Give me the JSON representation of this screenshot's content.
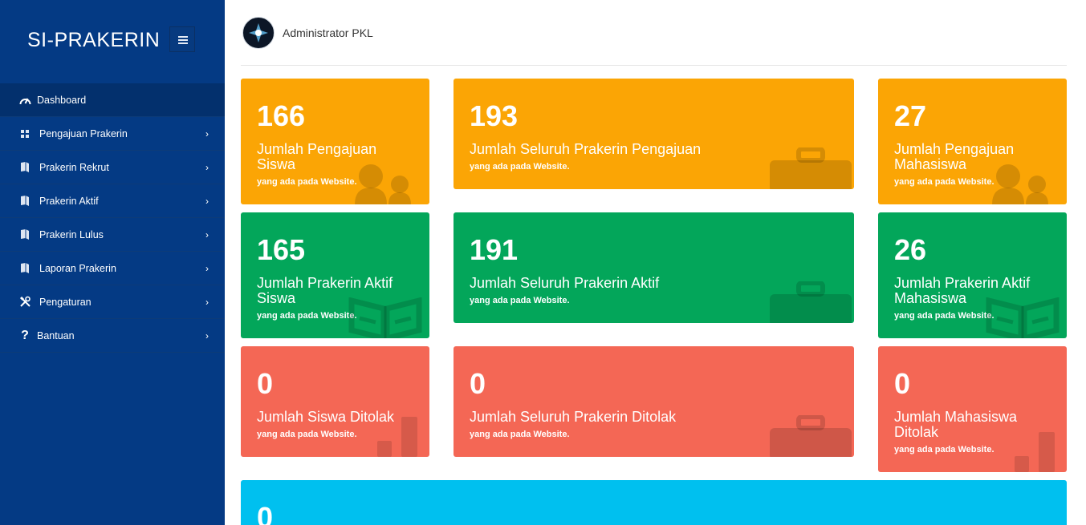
{
  "app": {
    "brand": "SI-PRAKERIN"
  },
  "sidebar": {
    "items": [
      {
        "label": "Dashboard",
        "icon": "dashboard-icon"
      },
      {
        "label": "Pengajuan Prakerin",
        "icon": "grid-icon"
      },
      {
        "label": "Prakerin Rekrut",
        "icon": "book-icon"
      },
      {
        "label": "Prakerin Aktif",
        "icon": "book-icon"
      },
      {
        "label": "Prakerin Lulus",
        "icon": "book-icon"
      },
      {
        "label": "Laporan Prakerin",
        "icon": "book-icon"
      },
      {
        "label": "Pengaturan",
        "icon": "tools-icon"
      },
      {
        "label": "Bantuan",
        "icon": "help-icon"
      }
    ],
    "chevron": "›"
  },
  "header": {
    "user_name": "Administrator PKL"
  },
  "colors": {
    "sidebar": "#043a84",
    "orange": "#fba505",
    "green": "#03a65a",
    "red": "#f46755",
    "blue": "#00c0ef"
  },
  "cards": [
    {
      "value": "166",
      "title": "Jumlah Pengajuan Siswa",
      "sub": "yang ada pada Website.",
      "icon": "users-icon"
    },
    {
      "value": "193",
      "title": "Jumlah Seluruh Prakerin Pengajuan",
      "sub": "yang ada pada Website.",
      "icon": "briefcase-icon"
    },
    {
      "value": "27",
      "title": "Jumlah Pengajuan Mahasiswa",
      "sub": "yang ada pada Website.",
      "icon": "users-icon"
    },
    {
      "value": "165",
      "title": "Jumlah Prakerin Aktif Siswa",
      "sub": "yang ada pada Website.",
      "icon": "book-open-icon"
    },
    {
      "value": "191",
      "title": "Jumlah Seluruh Prakerin Aktif",
      "sub": "yang ada pada Website.",
      "icon": "briefcase-icon"
    },
    {
      "value": "26",
      "title": "Jumlah Prakerin Aktif Mahasiswa",
      "sub": "yang ada pada Website.",
      "icon": "book-open-icon"
    },
    {
      "value": "0",
      "title": "Jumlah Siswa Ditolak",
      "sub": "yang ada pada Website.",
      "icon": "bar-chart-icon"
    },
    {
      "value": "0",
      "title": "Jumlah Seluruh Prakerin Ditolak",
      "sub": "yang ada pada Website.",
      "icon": "briefcase-icon"
    },
    {
      "value": "0",
      "title": "Jumlah Mahasiswa Ditolak",
      "sub": "yang ada pada Website.",
      "icon": "bar-chart-icon"
    },
    {
      "value": "0"
    }
  ]
}
